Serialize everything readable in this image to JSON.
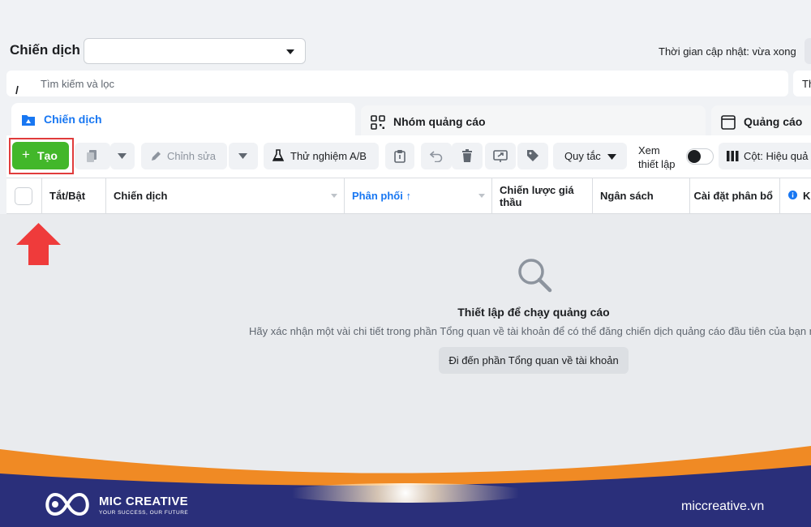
{
  "header": {
    "title": "Chiến dịch",
    "campaign_select_value": "",
    "update_status": "Thời gian cập nhật: vừa xong"
  },
  "search": {
    "placeholder": "Tìm kiếm và lọc",
    "right_button_label": "Th"
  },
  "tabs": [
    {
      "label": "Chiến dịch",
      "icon": "folder-icon",
      "active": true
    },
    {
      "label": "Nhóm quảng cáo",
      "icon": "grid-icon",
      "active": false
    },
    {
      "label": "Quảng cáo",
      "icon": "window-icon",
      "active": false
    }
  ],
  "toolbar": {
    "create_label": "Tạo",
    "edit_label": "Chỉnh sửa",
    "ab_test_label": "Thử nghiệm A/B",
    "rules_label": "Quy tắc",
    "view_setup_line1": "Xem",
    "view_setup_line2": "thiết lập",
    "columns_label": "Cột: Hiệu quả"
  },
  "table": {
    "columns": [
      "Tắt/Bật",
      "Chiến dịch",
      "Phân phối ↑",
      "Chiến lược giá thầu",
      "Ngân sách",
      "Cài đặt phân bổ",
      "K"
    ]
  },
  "empty_state": {
    "title": "Thiết lập để chạy quảng cáo",
    "description": "Hãy xác nhận một vài chi tiết trong phần Tổng quan về tài khoản để có thể đăng chiến dịch quảng cáo đầu tiên của bạn nhé",
    "button_label": "Đi đến phần Tổng quan về tài khoản"
  },
  "footer": {
    "brand_name": "MIC CREATIVE",
    "tagline": "YOUR SUCCESS, OUR FUTURE",
    "website": "miccreative.vn"
  },
  "colors": {
    "accent_blue": "#1877f2",
    "create_green": "#42b72a",
    "highlight_red": "#e03c3c",
    "footer_navy": "#2a2f7a",
    "footer_orange": "#f08a24"
  }
}
